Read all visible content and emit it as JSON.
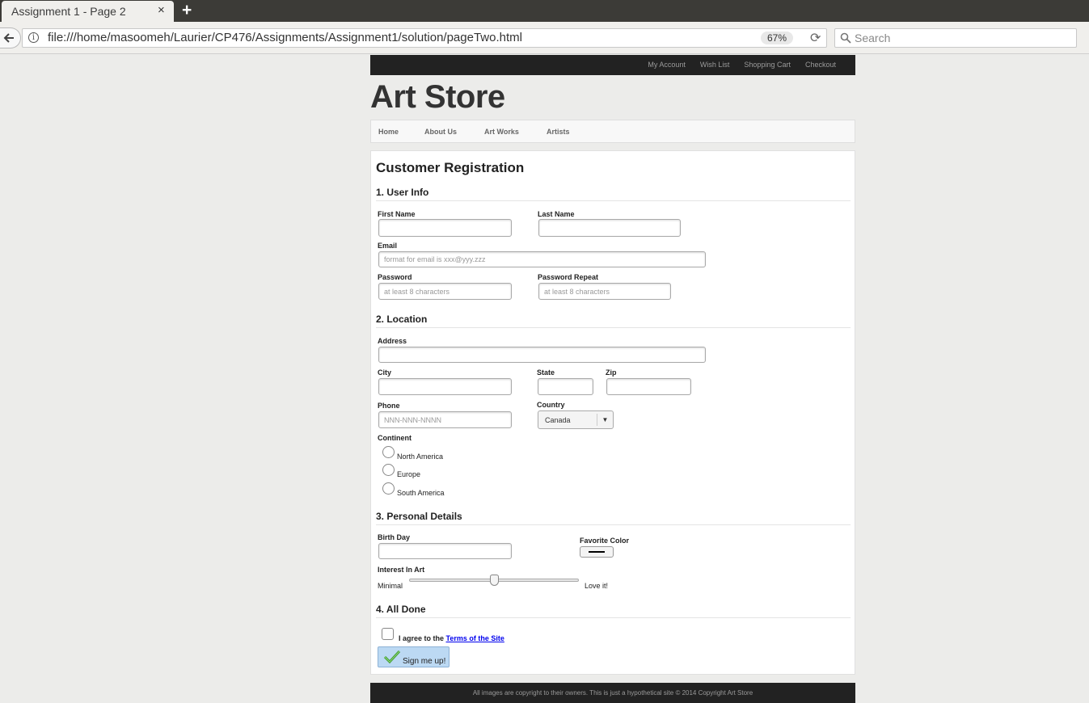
{
  "browser": {
    "tab_title": "Assignment 1 - Page 2",
    "tab_close": "×",
    "new_tab": "+",
    "url": "file:///home/masoomeh/Laurier/CP476/Assignments/Assignment1/solution/pageTwo.html",
    "zoom": "67%",
    "search_placeholder": "Search"
  },
  "header": {
    "top_links": [
      "My Account",
      "Wish List",
      "Shopping Cart",
      "Checkout"
    ],
    "brand": "Art Store",
    "nav": [
      "Home",
      "About Us",
      "Art Works",
      "Artists"
    ]
  },
  "form": {
    "title": "Customer Registration",
    "sections": [
      "1. User Info",
      "2. Location",
      "3. Personal Details",
      "4. All Done"
    ],
    "first_name": {
      "label": "First Name"
    },
    "last_name": {
      "label": "Last Name"
    },
    "email": {
      "label": "Email",
      "placeholder": "format for email is xxx@yyy.zzz"
    },
    "password": {
      "label": "Password",
      "placeholder": "at least 8 characters"
    },
    "password_repeat": {
      "label": "Password Repeat",
      "placeholder": "at least 8 characters"
    },
    "address": {
      "label": "Address"
    },
    "city": {
      "label": "City"
    },
    "state": {
      "label": "State"
    },
    "zip": {
      "label": "Zip"
    },
    "phone": {
      "label": "Phone",
      "placeholder": "NNN-NNN-NNNN"
    },
    "country": {
      "label": "Country",
      "value": "Canada"
    },
    "continent": {
      "label": "Continent",
      "options": [
        "North America",
        "Europe",
        "South America"
      ]
    },
    "birthday": {
      "label": "Birth Day"
    },
    "favorite_color": {
      "label": "Favorite Color",
      "value": "#000000"
    },
    "interest": {
      "label": "Interest In Art",
      "min_label": "Minimal",
      "max_label": "Love it!",
      "value_fraction": 0.5
    },
    "agree": {
      "text": "I agree to the ",
      "link": "Terms of the Site"
    },
    "submit": "Sign me up!"
  },
  "footer": {
    "text": "All images are copyright to their owners. This is just a hypothetical site © 2014 Copyright Art Store"
  }
}
